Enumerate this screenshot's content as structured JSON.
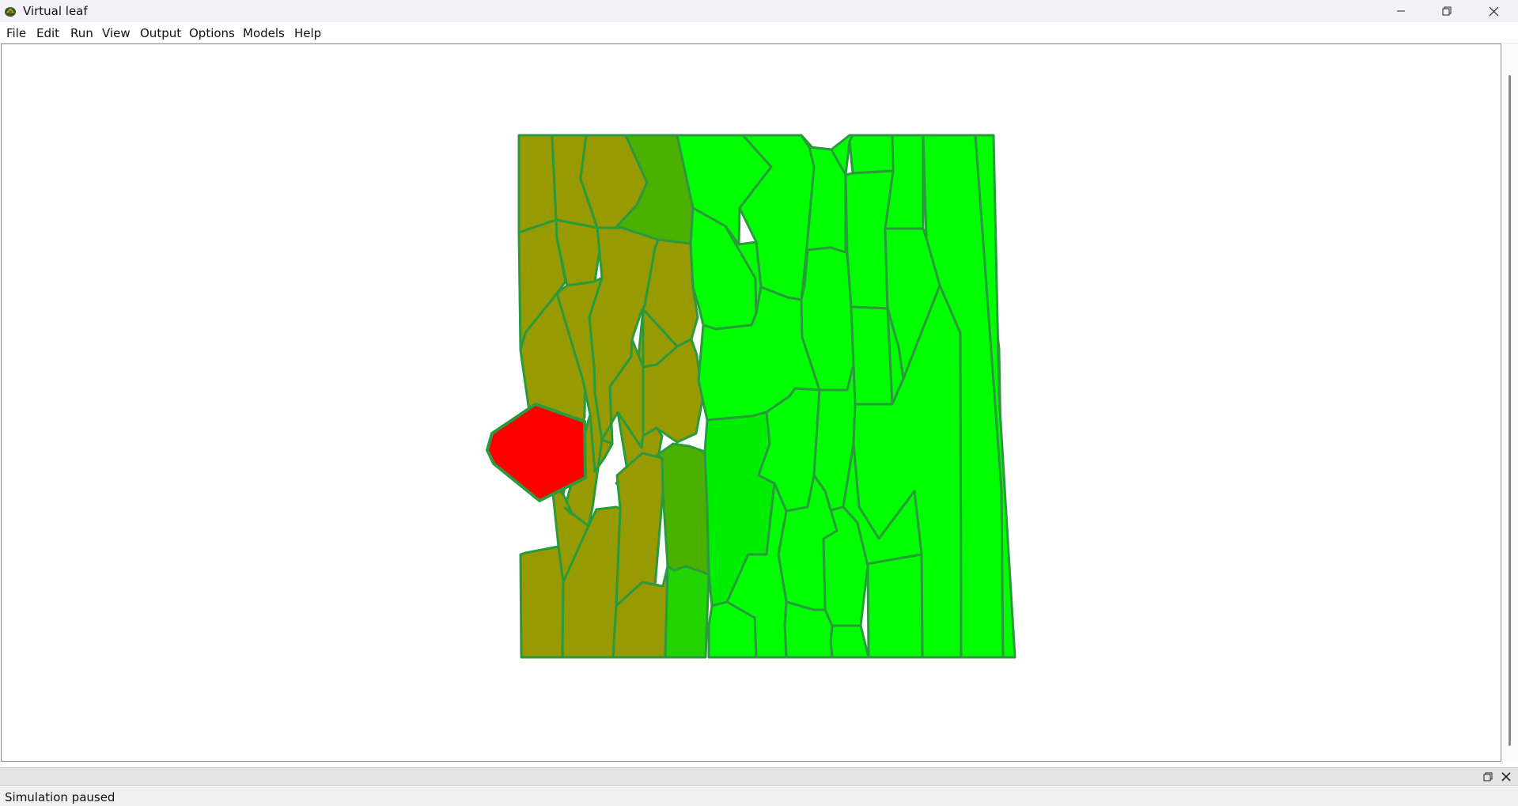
{
  "window": {
    "title": "Virtual leaf",
    "minimize_icon": "minimize-icon",
    "maximize_icon": "restore-icon",
    "close_icon": "close-icon"
  },
  "menu": {
    "items": [
      "File",
      "Edit",
      "Run",
      "View",
      "Output",
      "Options",
      "Models",
      "Help"
    ]
  },
  "colors": {
    "wall": "#2a9a3c",
    "cell_olive": "#979a00",
    "cell_green_dark": "#4bb000",
    "cell_green_mid": "#22d400",
    "cell_green_light": "#00ee00",
    "cell_bright": "#00ff00",
    "cell_selected": "#ff0000",
    "app_icon": "leaf-icon"
  },
  "status": {
    "text": "Simulation paused"
  }
}
